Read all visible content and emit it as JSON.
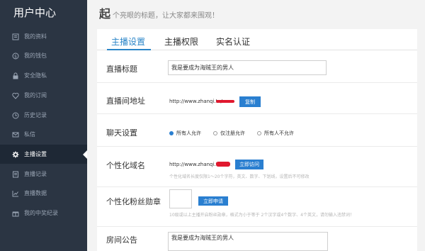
{
  "sidebar": {
    "title": "用户中心",
    "items": [
      {
        "label": "我的资料",
        "icon": "profile-icon"
      },
      {
        "label": "我的钱包",
        "icon": "wallet-icon"
      },
      {
        "label": "安全隐私",
        "icon": "lock-icon"
      },
      {
        "label": "我的订阅",
        "icon": "heart-icon"
      },
      {
        "label": "历史记录",
        "icon": "clock-icon"
      },
      {
        "label": "私信",
        "icon": "mail-icon"
      },
      {
        "label": "主播设置",
        "icon": "gear-icon",
        "active": true
      },
      {
        "label": "直播记录",
        "icon": "document-icon"
      },
      {
        "label": "直播数据",
        "icon": "chart-icon"
      },
      {
        "label": "我的中奖纪录",
        "icon": "gift-icon"
      }
    ]
  },
  "header": {
    "big_char": "起",
    "subtitle": "个亮眼的标题，让大家都来围观！"
  },
  "tabs": [
    {
      "label": "主播设置",
      "active": true
    },
    {
      "label": "主播权限"
    },
    {
      "label": "实名认证"
    }
  ],
  "form": {
    "title_label": "直播标题",
    "title_value": "我是要成为海贼王的男人",
    "room_label": "直播间地址",
    "room_url": "http://www.zhanqi.tv/",
    "copy_button": "复制",
    "chat_label": "聊天设置",
    "chat_options": [
      "所有人允许",
      "仅注册允许",
      "所有人不允许"
    ],
    "domain_label": "个性化域名",
    "domain_url": "http://www.zhanqi.tv/",
    "visit_button": "立即访问",
    "domain_hint": "个性化域名长度仅限1～20个字符，英文、数字、下划线，设置后不可修改",
    "badge_label": "个性化粉丝勋章",
    "badge_value": "",
    "apply_button": "立即申请",
    "badge_hint": "10级或以上主播开启粉丝勋章，格式为小于等于 2个汉字或4个数字、4个英文，请勿输入违禁词！",
    "notice_label": "房间公告",
    "notice_value": "我是要成为海贼王的男人"
  },
  "colors": {
    "sidebar_bg": "#2b3543",
    "accent": "#2a85c8",
    "button": "#2a7fd0",
    "redaction": "#e0182e"
  }
}
